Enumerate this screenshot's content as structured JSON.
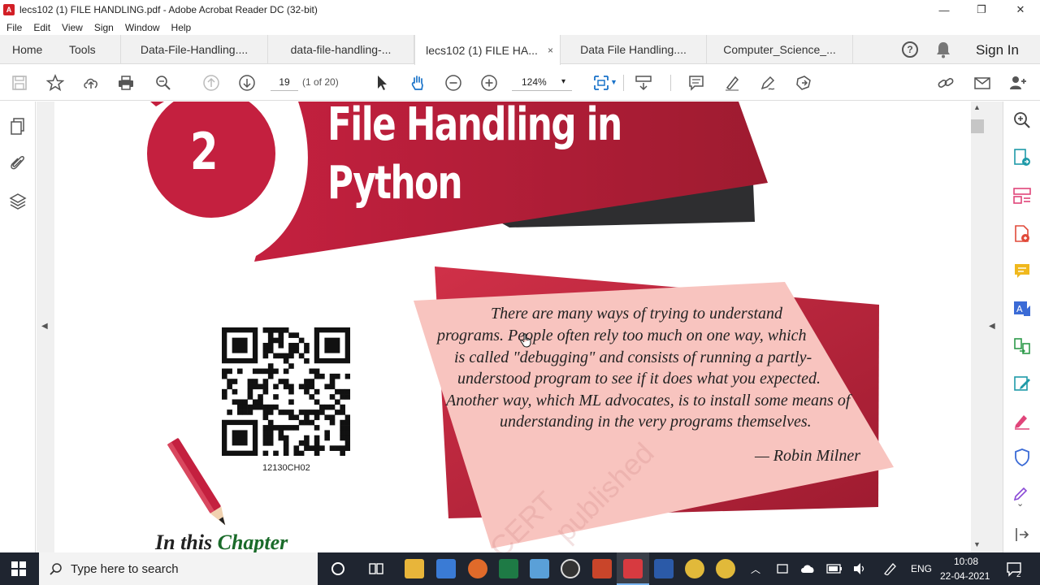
{
  "window": {
    "title": "lecs102 (1) FILE HANDLING.pdf - Adobe Acrobat Reader DC (32-bit)",
    "controls": {
      "minimize": "—",
      "maximize": "❐",
      "close": "✕"
    }
  },
  "menu": [
    "File",
    "Edit",
    "View",
    "Sign",
    "Window",
    "Help"
  ],
  "tabs": {
    "home": "Home",
    "tools": "Tools",
    "docs": [
      {
        "label": "Data-File-Handling...."
      },
      {
        "label": "data-file-handling-..."
      },
      {
        "label": "lecs102 (1) FILE HA...",
        "active": true,
        "close": "×"
      },
      {
        "label": "Data File Handling...."
      },
      {
        "label": "Computer_Science_..."
      }
    ],
    "help": "?",
    "sign_in": "Sign In"
  },
  "toolbar": {
    "page_number": "19",
    "page_of": "(1 of 20)",
    "zoom": "124%",
    "zoom_caret": "▾"
  },
  "page": {
    "chapter_number": "2",
    "chapter_title_line1": "File Handling in",
    "chapter_title_line2": "Python",
    "qr_code_label": "12130CH02",
    "quote": [
      "There are many ways of trying to understand",
      "programs. People often rely too much on one way, which",
      "is called \"debugging\" and consists of running a partly-",
      "understood program to see if it does what you expected.",
      "Another way, which ML advocates, is to install some means of",
      "understanding in the very programs themselves."
    ],
    "quote_author": "— Robin Milner",
    "watermark_line1": "CERT",
    "watermark_line2": "published",
    "section_heading_part1": "In this ",
    "section_heading_part2": "Chapter"
  },
  "taskbar": {
    "search_placeholder": "Type here to search",
    "language": "ENG",
    "time": "10:08",
    "date": "22-04-2021",
    "notification_count": "2"
  },
  "colors": {
    "accent_red": "#c4203f",
    "dark_red": "#8e1b2c",
    "quote_bg": "#f8c4bf",
    "taskbar_bg": "#1f2530"
  }
}
